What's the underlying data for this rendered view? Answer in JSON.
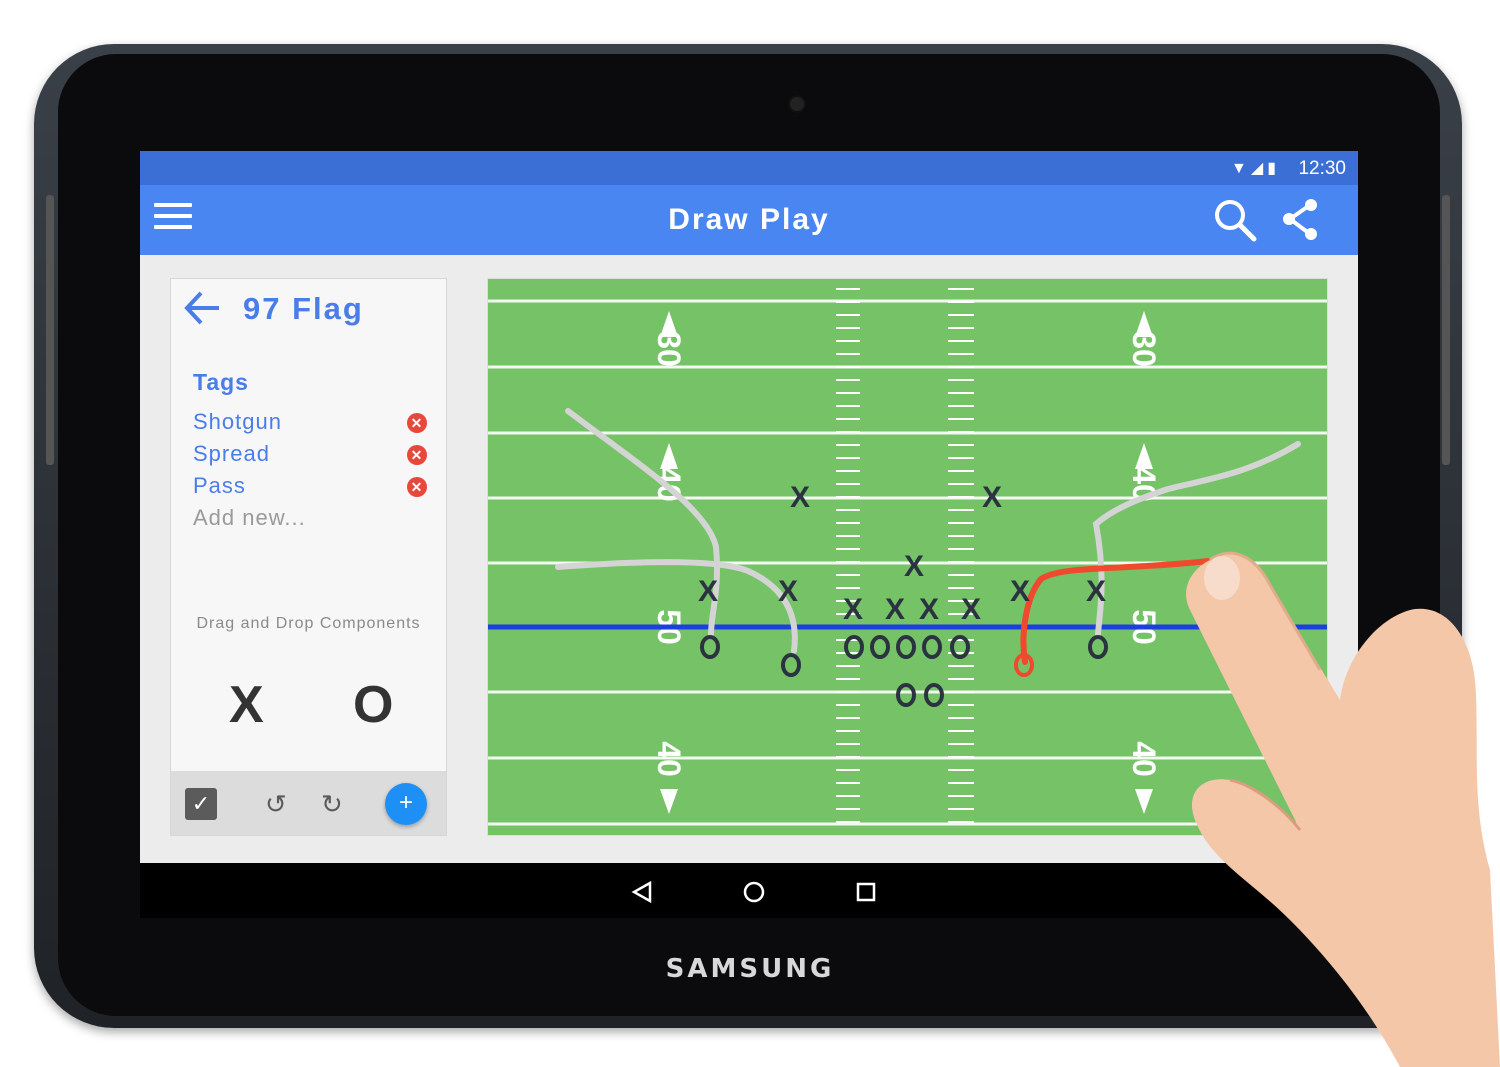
{
  "device": {
    "brand": "SAMSUNG"
  },
  "status_bar": {
    "time": "12:30",
    "icons": [
      "wifi-icon",
      "signal-icon",
      "battery-icon"
    ]
  },
  "app_bar": {
    "title": "Draw Play",
    "actions": [
      "search-icon",
      "share-icon"
    ]
  },
  "panel": {
    "play_name": "97 Flag",
    "tags_title": "Tags",
    "tags": [
      {
        "label": "Shotgun"
      },
      {
        "label": "Spread"
      },
      {
        "label": "Pass"
      }
    ],
    "add_new": "Add new...",
    "components_label": "Drag and Drop Components",
    "components": {
      "x": "X",
      "o": "O"
    },
    "toolbar": {
      "add_label": "+"
    }
  },
  "field": {
    "yard_numbers": [
      "30",
      "40",
      "50",
      "40"
    ],
    "colors": {
      "grass": "#75c267",
      "scrimmage": "#1d3fe0",
      "route": "#d4d4d4",
      "highlight_route": "#f04a2e",
      "player": "#2b3340"
    }
  },
  "nav_bar": {
    "buttons": [
      "back-icon",
      "home-icon",
      "recents-icon"
    ]
  },
  "colors": {
    "appbar": "#4a86f2",
    "statusbar": "#3b6fd6",
    "accent": "#4a7de8",
    "fab": "#1e90f5"
  }
}
